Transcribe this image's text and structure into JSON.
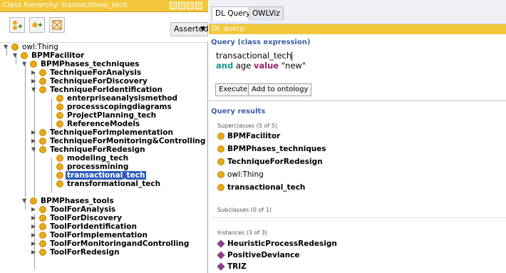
{
  "left_panel": {
    "title": "Class hierarchy: transactional_tech",
    "mode": "Asserted"
  },
  "tree": [
    {
      "label": "owl:Thing"
    },
    {
      "label": "BPMFacilitor"
    },
    {
      "label": "BPMPhases_techniques"
    },
    {
      "label": "TechniqueForAnalysis"
    },
    {
      "label": "TechniqueForDiscovery"
    },
    {
      "label": "TechniqueForIdentification"
    },
    {
      "label": "enterpriseanalysismethod"
    },
    {
      "label": "processscopingdiagrams"
    },
    {
      "label": "ProjectPlanning_tech"
    },
    {
      "label": "ReferenceModels"
    },
    {
      "label": "TechniqueForImplementation"
    },
    {
      "label": "TechniqueForMonitoring&Controlling"
    },
    {
      "label": "TechniqueForRedesign"
    },
    {
      "label": "modeling_tech"
    },
    {
      "label": "processmining"
    },
    {
      "label": "transactional_tech"
    },
    {
      "label": "transformational_tech"
    },
    {
      "label": "BPMPhases_tools"
    },
    {
      "label": "ToolForAnalysis"
    },
    {
      "label": "ToolForDiscovery"
    },
    {
      "label": "ToolForIdentification"
    },
    {
      "label": "ToolForImplementation"
    },
    {
      "label": "ToolForMonitoringandControlling"
    },
    {
      "label": "ToolForRedesign"
    }
  ],
  "right_panel": {
    "tabs": [
      "DL Query",
      "OWLViz"
    ],
    "header": "DL query:",
    "query_section_label": "Query (class expression)",
    "query": {
      "line1": "transactional_tech",
      "line2_and": "and",
      "line2_mid": " age ",
      "line2_value": "value",
      "line2_rest": " \"new\""
    },
    "buttons": {
      "execute": "Execute",
      "add": "Add to ontology"
    },
    "results_label": "Query results",
    "superclasses_header": "Superclasses (5 of 5)",
    "superclasses": [
      "BPMFacilitor",
      "BPMPhases_techniques",
      "TechniqueForRedesign",
      "owl:Thing",
      "transactional_tech"
    ],
    "subclasses_header": "Subclasses (0 of 1)",
    "instances_header": "Instances (3 of 3)",
    "instances": [
      "HeuristicProcessRedesign",
      "PositiveDeviance",
      "TRIZ"
    ]
  }
}
